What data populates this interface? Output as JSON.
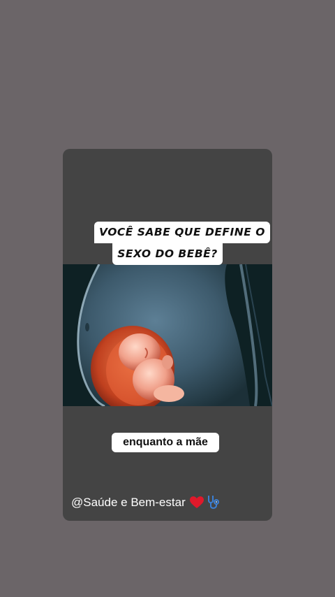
{
  "story": {
    "headline_line1": "VOCÊ SABE QUE DEFINE O",
    "headline_line2": "SEXO DO BEBÊ?",
    "caption": "enquanto a mãe",
    "handle": "@Saúde e Bem-estar",
    "handle_icons": [
      "heart-icon",
      "stethoscope-icon"
    ]
  },
  "colors": {
    "page_background": "#6b6568",
    "card_background": "#444444",
    "video_background": "#0e2124",
    "label_background": "#ffffff",
    "heart": "#e0192b",
    "stethoscope": "#3b7fd4"
  }
}
